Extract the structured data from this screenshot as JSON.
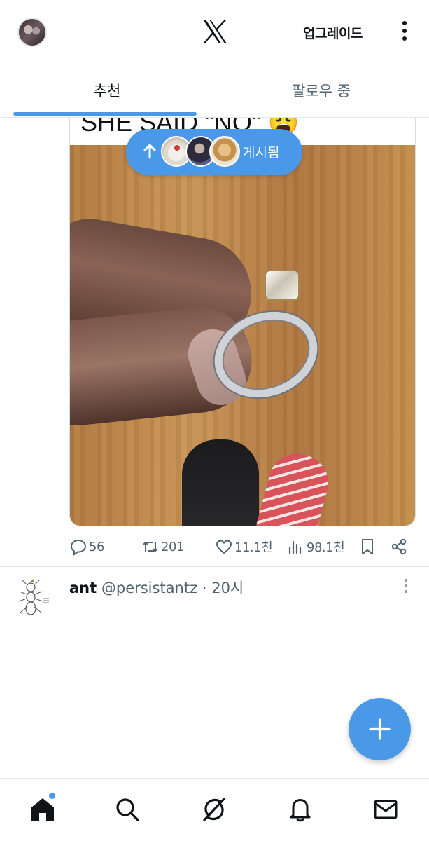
{
  "header": {
    "logo": "X",
    "upgrade_label": "업그레이드"
  },
  "tabs": [
    {
      "label": "추천",
      "active": true
    },
    {
      "label": "팔로우 중",
      "active": false
    }
  ],
  "new_posts_pill": {
    "label": "게시됨",
    "icon": "arrow-up-icon"
  },
  "post": {
    "caption": "SHE SAID \"NO\" 😩",
    "stats": {
      "replies": "56",
      "reposts": "201",
      "likes": "11.1천",
      "views": "98.1천"
    }
  },
  "next_post": {
    "name": "ant",
    "handle": "@persistantz",
    "separator": "·",
    "time": "20시"
  },
  "colors": {
    "accent": "#4a99e9",
    "text_primary": "#0f1419",
    "text_secondary": "#536471",
    "divider": "#e1e8ed"
  },
  "bottom_nav": [
    {
      "icon": "home-icon",
      "active": true,
      "has_badge": true
    },
    {
      "icon": "search-icon"
    },
    {
      "icon": "grok-icon"
    },
    {
      "icon": "bell-icon"
    },
    {
      "icon": "mail-icon"
    }
  ]
}
